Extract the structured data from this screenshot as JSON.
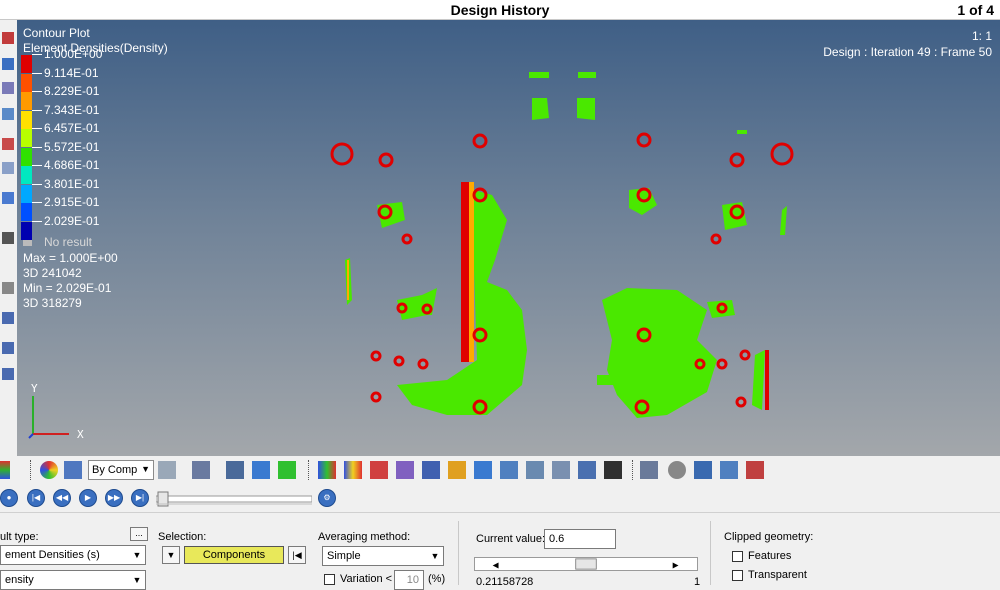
{
  "titlebar": {
    "title": "Design History",
    "page_indicator": "1 of 4"
  },
  "legend": {
    "title": "Contour Plot",
    "subtitle": "Element Densities(Density)",
    "levels": [
      {
        "label": "1.000E+00",
        "color": "#e00000"
      },
      {
        "label": "9.114E-01",
        "color": "#ff5000"
      },
      {
        "label": "8.229E-01",
        "color": "#ff9a00"
      },
      {
        "label": "7.343E-01",
        "color": "#ffe000"
      },
      {
        "label": "6.457E-01",
        "color": "#b8ff00"
      },
      {
        "label": "5.572E-01",
        "color": "#30e000"
      },
      {
        "label": "4.686E-01",
        "color": "#00e8c0"
      },
      {
        "label": "3.801E-01",
        "color": "#00a8ff"
      },
      {
        "label": "2.915E-01",
        "color": "#0050ff"
      },
      {
        "label": "2.029E-01",
        "color": "#0000b0"
      }
    ],
    "no_result": "No result",
    "max_text": "Max = 1.000E+00",
    "max_elem": "3D 241042",
    "min_text": "Min = 2.029E-01",
    "min_elem": "3D 318279"
  },
  "view": {
    "scale": "1: 1",
    "design_info": "Design : Iteration 49 : Frame 50",
    "axis_y": "Y",
    "axis_x": "X"
  },
  "toolbar": {
    "by_comp": "By Comp"
  },
  "panel": {
    "result_type_label": "ult type:",
    "result_type_value": "ement Densities (s)",
    "result_sub_value": "ensity",
    "selection_label": "Selection:",
    "selection_button": "Components",
    "averaging_label": "Averaging method:",
    "averaging_value": "Simple",
    "variation_label": "Variation <",
    "variation_value": "10",
    "variation_unit": "(%)",
    "current_value_label": "Current value:",
    "current_value": "0.6",
    "slider_min": "0.21158728",
    "slider_max": "1",
    "clipped_label": "Clipped geometry:",
    "features_label": "Features",
    "transparent_label": "Transparent"
  }
}
